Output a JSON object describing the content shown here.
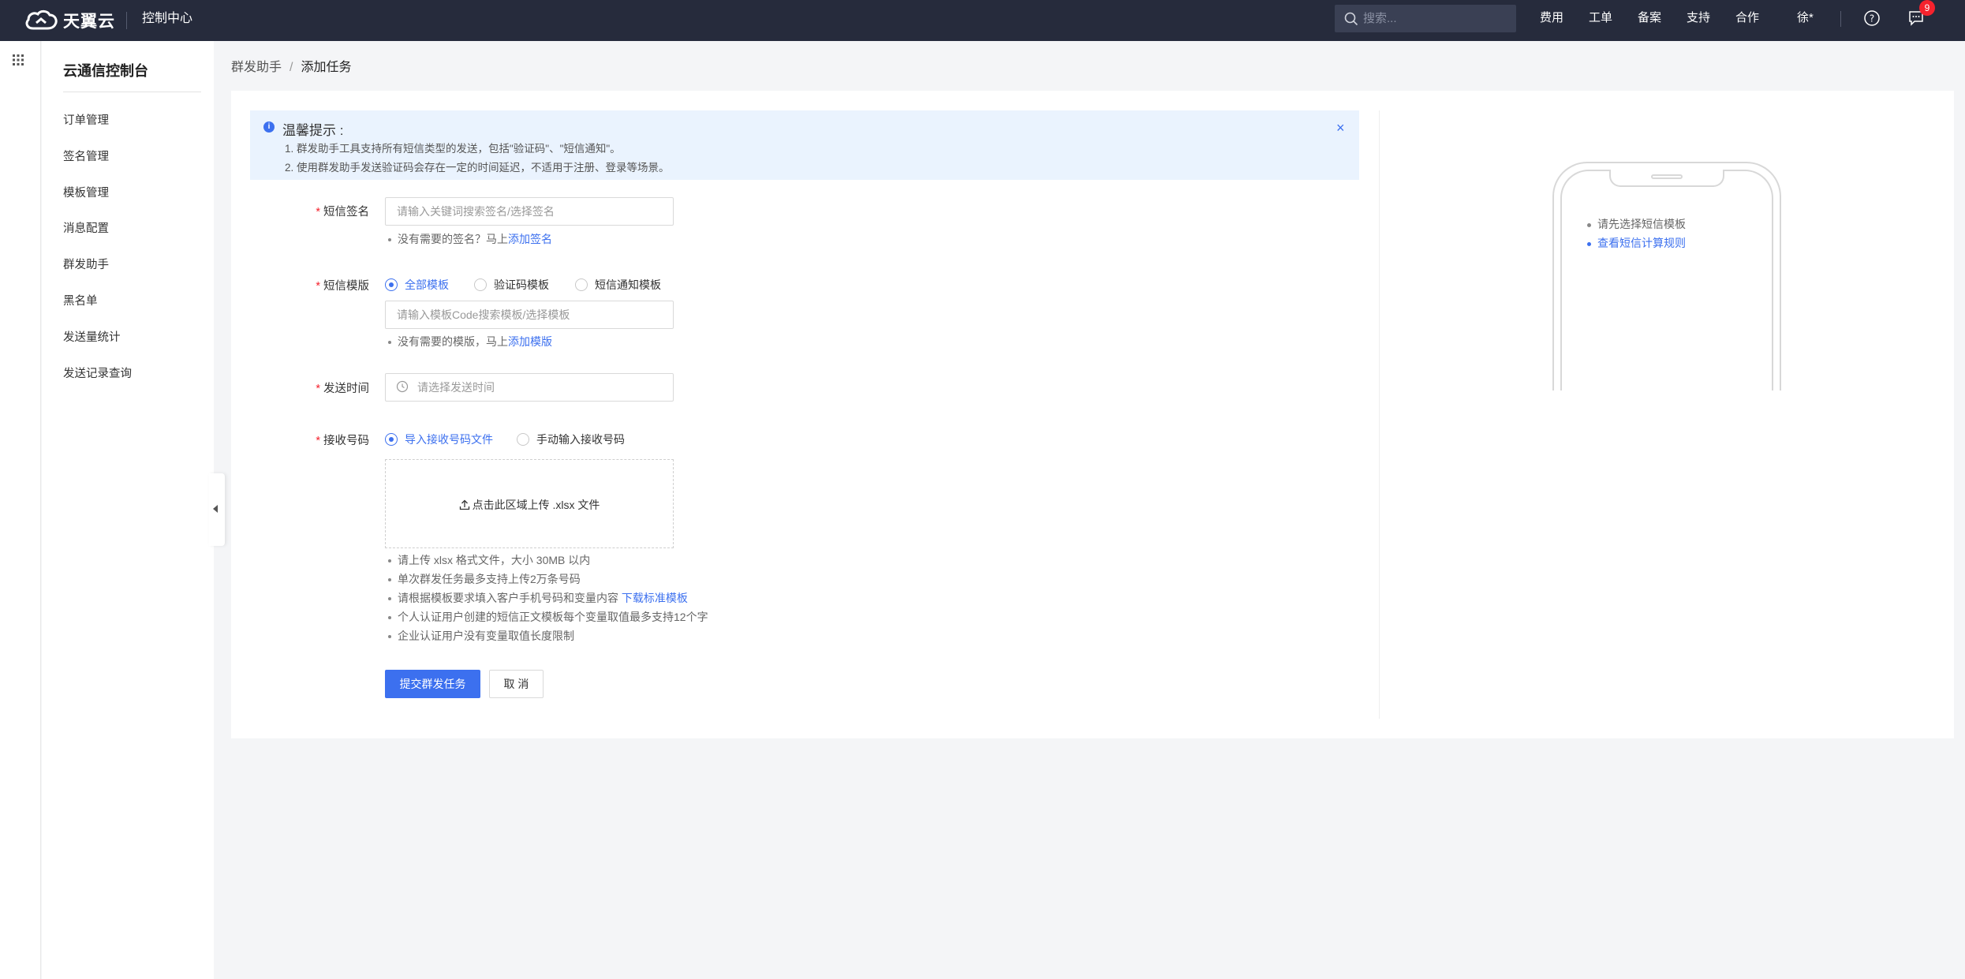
{
  "topbar": {
    "brand": "天翼云",
    "console_link": "控制中心",
    "search_placeholder": "搜索...",
    "nav": [
      "费用",
      "工单",
      "备案",
      "支持",
      "合作"
    ],
    "user": "徐*",
    "message_badge": "9"
  },
  "sidebar": {
    "title": "云通信控制台",
    "items": [
      "订单管理",
      "签名管理",
      "模板管理",
      "消息配置",
      "群发助手",
      "黑名单",
      "发送量统计",
      "发送记录查询"
    ]
  },
  "breadcrumb": {
    "parent": "群发助手",
    "separator": "/",
    "current": "添加任务"
  },
  "notice": {
    "title": "温馨提示 :",
    "lines": [
      "1. 群发助手工具支持所有短信类型的发送，包括\"验证码\"、\"短信通知\"。",
      "2. 使用群发助手发送验证码会存在一定的时间延迟，不适用于注册、登录等场景。"
    ],
    "close": "×"
  },
  "form": {
    "signature": {
      "label": "短信签名",
      "placeholder": "请输入关键词搜索签名/选择签名",
      "hint_prefix": "没有需要的签名？马上",
      "hint_link": "添加签名"
    },
    "template": {
      "label": "短信模版",
      "radios": [
        "全部模板",
        "验证码模板",
        "短信通知模板"
      ],
      "placeholder": "请输入模板Code搜索模板/选择模板",
      "hint_prefix": "没有需要的模版，马上",
      "hint_link": "添加模版"
    },
    "send_time": {
      "label": "发送时间",
      "placeholder": "请选择发送时间"
    },
    "receiver": {
      "label": "接收号码",
      "radios": [
        "导入接收号码文件",
        "手动输入接收号码"
      ],
      "upload_text": "点击此区域上传 .xlsx 文件",
      "tips": [
        {
          "text": "请上传 xlsx 格式文件，大小 30MB 以内",
          "link": ""
        },
        {
          "text": "单次群发任务最多支持上传2万条号码",
          "link": ""
        },
        {
          "text": "请根据模板要求填入客户手机号码和变量内容 ",
          "link": "下载标准模板"
        },
        {
          "text": "个人认证用户创建的短信正文模板每个变量取值最多支持12个字",
          "link": ""
        },
        {
          "text": "企业认证用户没有变量取值长度限制",
          "link": ""
        }
      ]
    },
    "submit_label": "提交群发任务",
    "cancel_label": "取 消"
  },
  "preview": {
    "line1": "请先选择短信模板",
    "line2": "查看短信计算规则"
  },
  "colors": {
    "topbar_bg": "#262b3c",
    "accent": "#3c70ef",
    "required": "#f5222d",
    "notice_bg": "#eaf3fe"
  },
  "icons": [
    "cloud-logo-icon",
    "search-icon",
    "help-icon",
    "message-icon",
    "apps-grid-icon",
    "collapse-arrow-icon",
    "info-icon",
    "close-icon",
    "clock-icon",
    "upload-icon"
  ]
}
